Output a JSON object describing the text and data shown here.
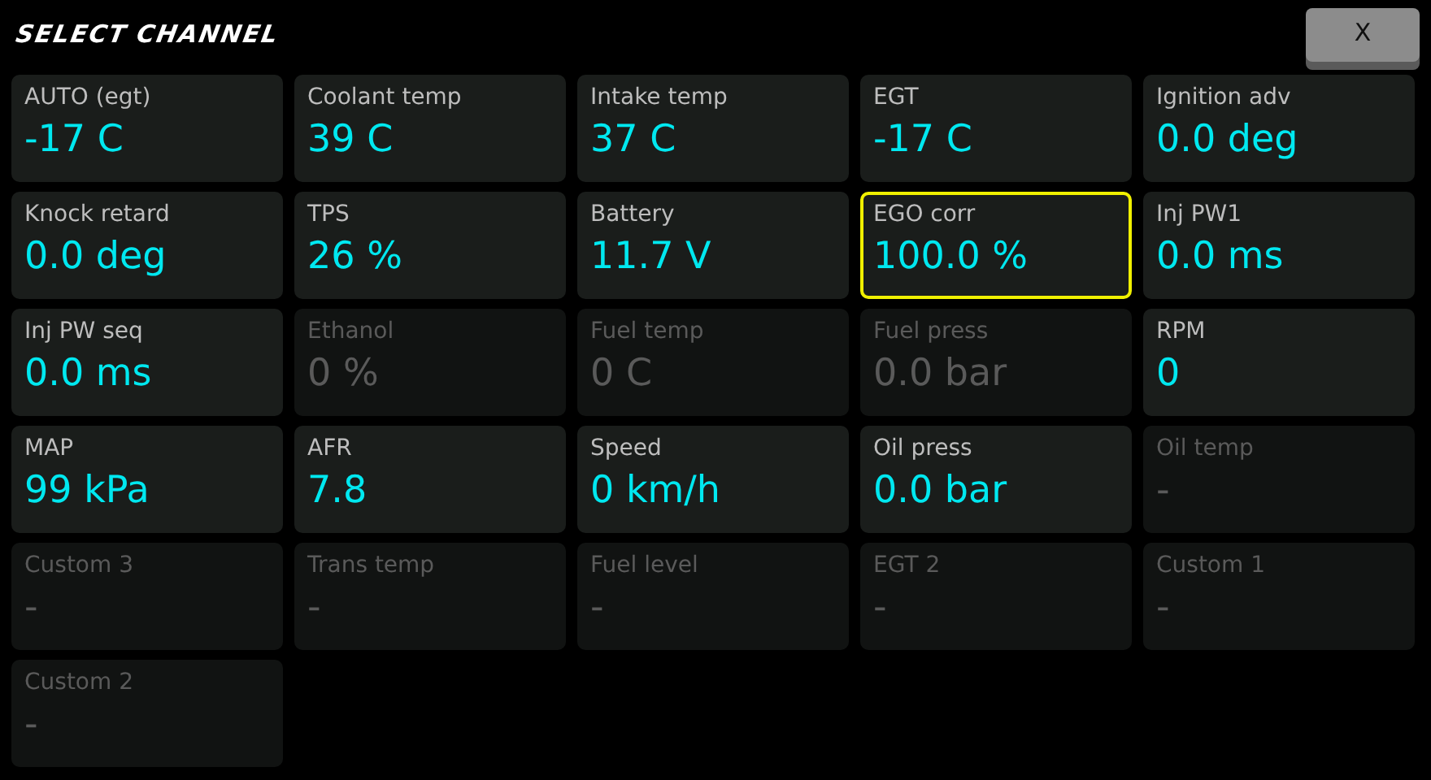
{
  "title": "SELECT CHANNEL",
  "close_button": "X",
  "channels": [
    {
      "name": "AUTO (egt)",
      "value": "-17 C",
      "active": true,
      "selected": false
    },
    {
      "name": "Coolant temp",
      "value": "39 C",
      "active": true,
      "selected": false
    },
    {
      "name": "Intake temp",
      "value": "37 C",
      "active": true,
      "selected": false
    },
    {
      "name": "EGT",
      "value": "-17 C",
      "active": true,
      "selected": false
    },
    {
      "name": "Ignition adv",
      "value": "0.0 deg",
      "active": true,
      "selected": false
    },
    {
      "name": "Knock retard",
      "value": "0.0 deg",
      "active": true,
      "selected": false
    },
    {
      "name": "TPS",
      "value": "26 %",
      "active": true,
      "selected": false
    },
    {
      "name": "Battery",
      "value": "11.7 V",
      "active": true,
      "selected": false
    },
    {
      "name": "EGO corr",
      "value": "100.0 %",
      "active": true,
      "selected": true
    },
    {
      "name": "Inj PW1",
      "value": "0.0 ms",
      "active": true,
      "selected": false
    },
    {
      "name": "Inj PW seq",
      "value": "0.0 ms",
      "active": true,
      "selected": false
    },
    {
      "name": "Ethanol",
      "value": "0 %",
      "active": false,
      "selected": false
    },
    {
      "name": "Fuel temp",
      "value": "0 C",
      "active": false,
      "selected": false
    },
    {
      "name": "Fuel press",
      "value": "0.0 bar",
      "active": false,
      "selected": false
    },
    {
      "name": "RPM",
      "value": "0",
      "active": true,
      "selected": false
    },
    {
      "name": "MAP",
      "value": "99 kPa",
      "active": true,
      "selected": false
    },
    {
      "name": "AFR",
      "value": "7.8",
      "active": true,
      "selected": false
    },
    {
      "name": "Speed",
      "value": "0 km/h",
      "active": true,
      "selected": false
    },
    {
      "name": "Oil press",
      "value": "0.0 bar",
      "active": true,
      "selected": false
    },
    {
      "name": "Oil temp",
      "value": "-",
      "active": false,
      "selected": false
    },
    {
      "name": "Custom 3",
      "value": "-",
      "active": false,
      "selected": false
    },
    {
      "name": "Trans temp",
      "value": "-",
      "active": false,
      "selected": false
    },
    {
      "name": "Fuel level",
      "value": "-",
      "active": false,
      "selected": false
    },
    {
      "name": "EGT 2",
      "value": "-",
      "active": false,
      "selected": false
    },
    {
      "name": "Custom 1",
      "value": "-",
      "active": false,
      "selected": false
    },
    {
      "name": "Custom 2",
      "value": "-",
      "active": false,
      "selected": false
    }
  ]
}
